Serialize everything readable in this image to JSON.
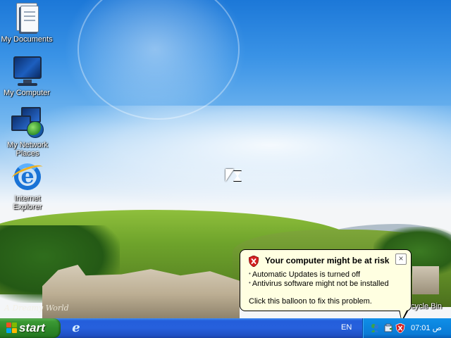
{
  "desktop": {
    "icons": [
      {
        "label": "My Documents",
        "icon": "my-documents-icon"
      },
      {
        "label": "My Computer",
        "icon": "my-computer-icon"
      },
      {
        "label": "My Network Places",
        "icon": "my-network-places-icon"
      },
      {
        "label": "Internet Explorer",
        "icon": "internet-explorer-icon"
      }
    ],
    "recycle_bin_label": "cycle Bin",
    "wallpaper_signature": "A Dreamy World"
  },
  "cursor": {
    "state": "busy",
    "icon": "hourglass-cursor-icon"
  },
  "balloon": {
    "title": "Your computer might be at risk",
    "icon": "security-shield-icon",
    "lines": [
      "Automatic Updates is turned off",
      "Antivirus software might not be installed"
    ],
    "action": "Click this balloon to fix this problem.",
    "close_label": "×"
  },
  "taskbar": {
    "start_label": "start",
    "quick_launch": [
      "internet-explorer-icon"
    ],
    "language": "EN",
    "tray_icons": [
      "messenger-icon",
      "safely-remove-hardware-icon",
      "security-alert-icon"
    ],
    "clock": "07:01 ص"
  },
  "colors": {
    "taskbar_blue": "#245edb",
    "start_green": "#2f8a2a",
    "balloon_bg": "#ffffe1",
    "alert_red": "#d42020"
  }
}
